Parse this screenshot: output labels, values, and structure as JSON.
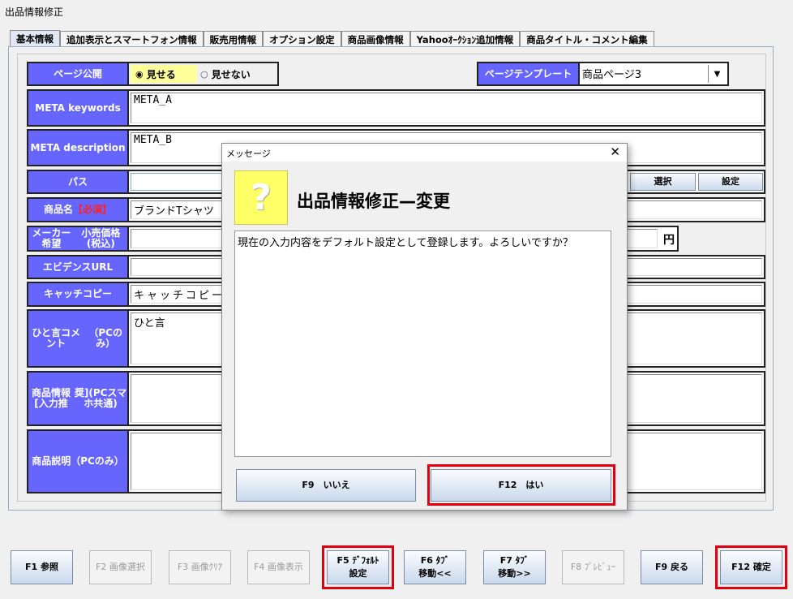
{
  "window": {
    "title": "出品情報修正"
  },
  "tabs": [
    "基本情報",
    "追加表示とスマートフォン情報",
    "販売用情報",
    "オプション設定",
    "商品画像情報",
    "Yahooｵｰｸｼｮﾝ追加情報",
    "商品タイトル・コメント編集"
  ],
  "form": {
    "page_public": {
      "label": "ページ公開",
      "options": [
        "見せる",
        "見せない"
      ],
      "selected": "見せる"
    },
    "page_template": {
      "label": "ページテンプレート",
      "value": "商品ページ3"
    },
    "meta_keywords": {
      "label": "META keywords",
      "value": "META_A"
    },
    "meta_description": {
      "label": "META description",
      "value": "META_B"
    },
    "path": {
      "label": "パス",
      "value": "",
      "select_button": "選択",
      "set_button": "設定"
    },
    "product_name": {
      "label": "商品名",
      "required": "【必須】",
      "value": "ブランドTシャツ"
    },
    "maker_price": {
      "label1": "メーカー希望",
      "label2": "小売価格(税込)",
      "value": "",
      "unit": "円"
    },
    "evidence_url": {
      "label": "エビデンスURL",
      "value": ""
    },
    "catch_copy": {
      "label": "キャッチコピー",
      "value": "キャッチコピー"
    },
    "comment": {
      "label1": "ひと言コメント",
      "label2": "（PCのみ）",
      "value": "ひと言"
    },
    "product_info": {
      "label1": "商品情報[入力推",
      "label2": "奨](PCスマホ共通)",
      "value": ""
    },
    "description": {
      "label1": "商品説明",
      "label2": "（PCのみ）",
      "value": ""
    }
  },
  "dialog": {
    "title": "メッセージ",
    "icon": "question-icon",
    "icon_glyph": "?",
    "heading": "出品情報修正—変更",
    "message": "現在の入力内容をデフォルト設定として登録します。よろしいですか？",
    "no_button": "F9　いいえ",
    "yes_button": "F12　はい"
  },
  "fkeys": [
    {
      "l1": "F1 参照",
      "l2": "",
      "enabled": true
    },
    {
      "l1": "F2 画像選択",
      "l2": "",
      "enabled": false
    },
    {
      "l1": "F3 画像ｸﾘｱ",
      "l2": "",
      "enabled": false
    },
    {
      "l1": "F4 画像表示",
      "l2": "",
      "enabled": false
    },
    {
      "l1": "F5 ﾃﾞﾌｫﾙﾄ",
      "l2": "設定",
      "enabled": true
    },
    {
      "l1": "F6 ﾀﾌﾞ",
      "l2": "移動<<",
      "enabled": true
    },
    {
      "l1": "F7 ﾀﾌﾞ",
      "l2": "移動>>",
      "enabled": true
    },
    {
      "l1": "F8 ﾌﾟﾚﾋﾞｭｰ",
      "l2": "",
      "enabled": false
    },
    {
      "l1": "F9 戻る",
      "l2": "",
      "enabled": true
    },
    {
      "l1": "F12 確定",
      "l2": "",
      "enabled": true
    }
  ],
  "colors": {
    "label_bg": "#6666ff",
    "highlight": "#e0000f",
    "icon_bg": "#ffff66"
  }
}
